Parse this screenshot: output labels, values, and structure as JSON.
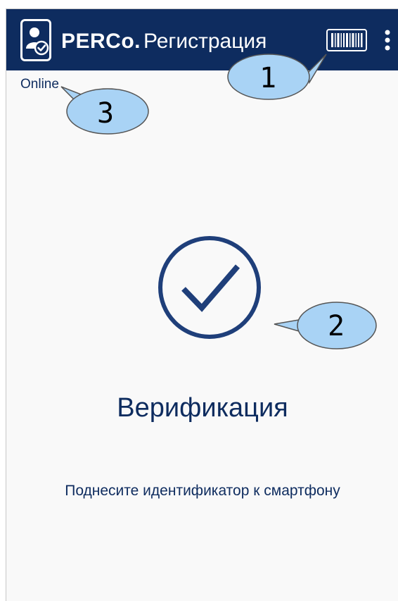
{
  "app": {
    "brand": "PERCo.",
    "screen_title": "Регистрация"
  },
  "toolbar": {
    "barcode_icon": "barcode-icon",
    "more_icon": "more-vert-icon"
  },
  "status": {
    "connection": "Online"
  },
  "main": {
    "heading": "Верификация",
    "hint": "Поднесите идентификатор к смартфону",
    "status_icon": "check-circle-icon"
  },
  "callouts": [
    {
      "number": "1"
    },
    {
      "number": "2"
    },
    {
      "number": "3"
    }
  ],
  "colors": {
    "appbar": "#0e2c5f",
    "accent": "#1f3f7a",
    "callout_fill": "#a9d3f5",
    "background": "#f9f9f9"
  }
}
